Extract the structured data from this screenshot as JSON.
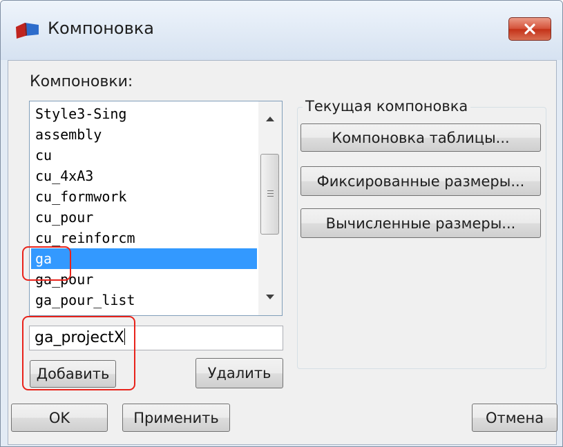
{
  "window": {
    "title": "Компоновка",
    "close_icon": "close-x-icon",
    "app_icon": "layout-app-icon"
  },
  "layouts_label": "Компоновки:",
  "layouts_list": {
    "items": [
      {
        "label": "Style3-Sing",
        "selected": false
      },
      {
        "label": "assembly",
        "selected": false
      },
      {
        "label": "cu",
        "selected": false
      },
      {
        "label": "cu_4xA3",
        "selected": false
      },
      {
        "label": "cu_formwork",
        "selected": false
      },
      {
        "label": "cu_pour",
        "selected": false
      },
      {
        "label": "cu_reinforcm",
        "selected": false
      },
      {
        "label": "ga",
        "selected": true
      },
      {
        "label": "ga_pour",
        "selected": false
      },
      {
        "label": "ga_pour_list",
        "selected": false
      }
    ]
  },
  "new_layout_input": {
    "value": "ga_projectX"
  },
  "buttons": {
    "add": "Добавить",
    "delete": "Удалить",
    "ok": "OK",
    "apply": "Применить",
    "cancel": "Отмена"
  },
  "current_layout": {
    "title": "Текущая компоновка",
    "table_layout_button": "Компоновка таблицы...",
    "fixed_sizes_button": "Фиксированные размеры...",
    "calculated_sizes_button": "Вычисленные размеры..."
  },
  "colors": {
    "selection": "#3399ff",
    "highlight_annotation": "#e8221a",
    "close_button": "#c43219"
  }
}
